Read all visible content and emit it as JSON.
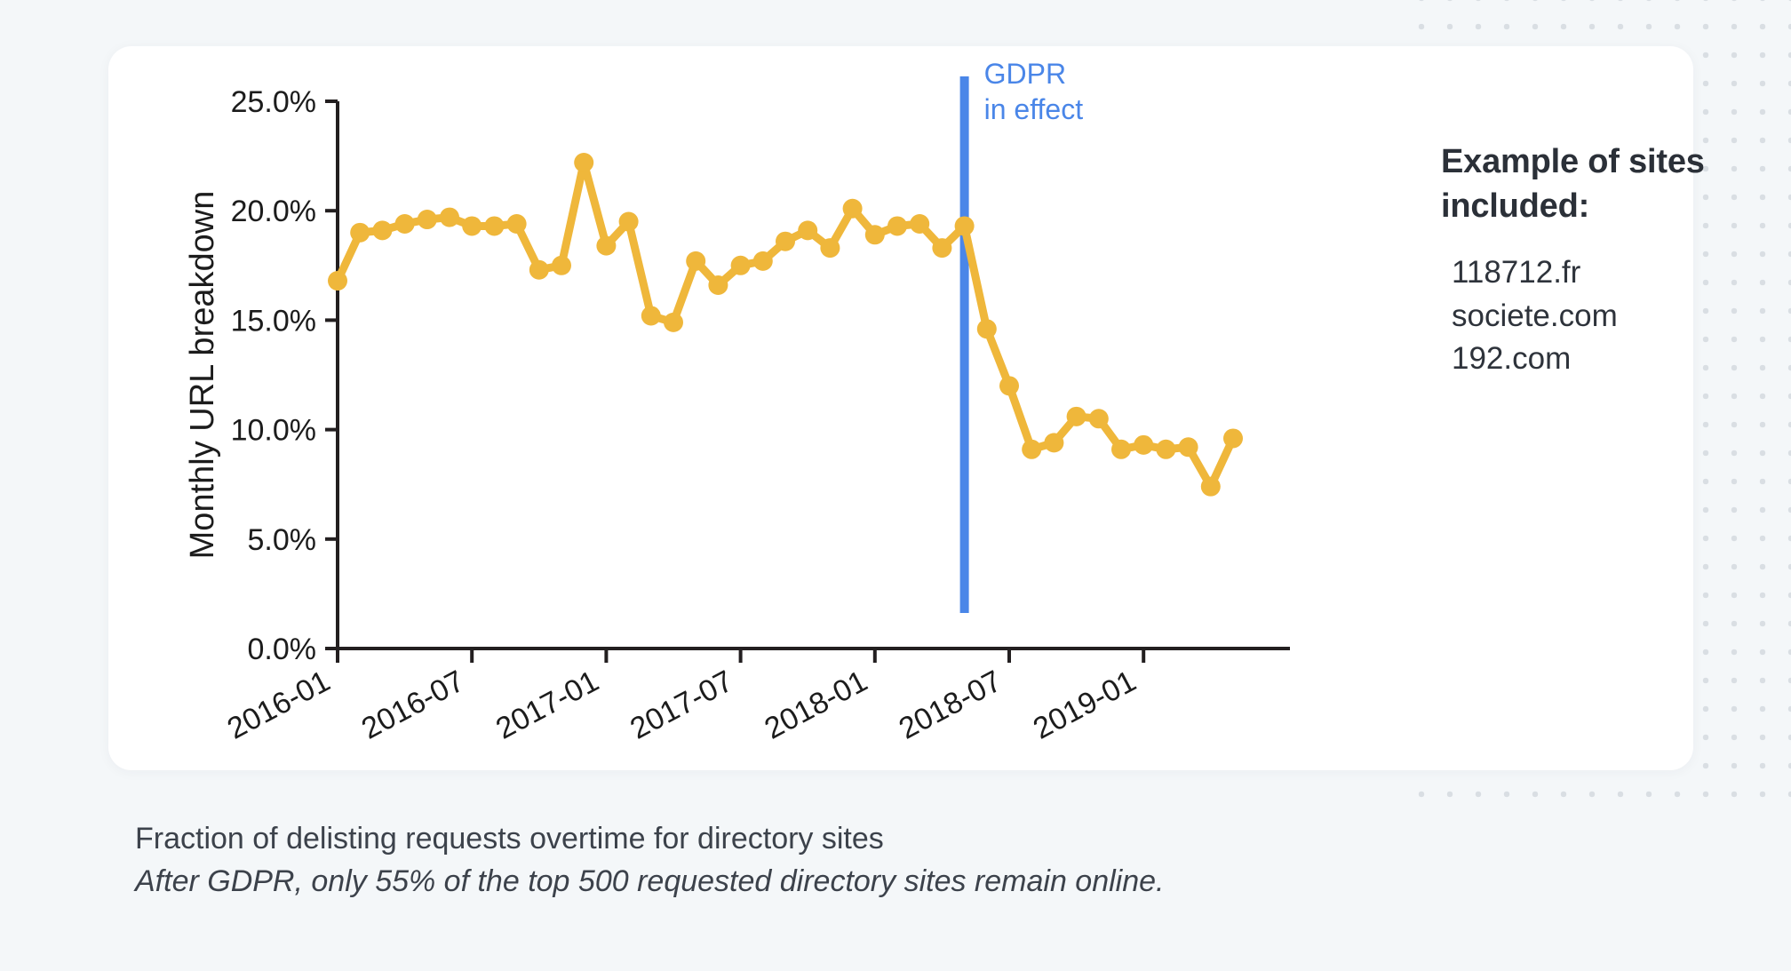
{
  "colors": {
    "page_background": "#f4f7f9",
    "card_background": "#ffffff",
    "series_gold": "#efb73b",
    "gdpr_blue": "#4a86e8",
    "axis_black": "#231f20",
    "text_dark": "#2b3038",
    "dot_grid": "#d9dee3"
  },
  "side_panel": {
    "title": "Example of sites included:",
    "sites": [
      "118712.fr",
      "societe.com",
      "192.com"
    ]
  },
  "caption": {
    "line1": "Fraction of delisting requests overtime for directory sites",
    "line2": "After GDPR, only 55% of the top 500 requested directory sites remain online."
  },
  "chart_data": {
    "type": "line",
    "title": "",
    "xlabel": "",
    "ylabel": "Monthly URL breakdown",
    "ylim": [
      0,
      25
    ],
    "ytick_labels": [
      "0.0%",
      "5.0%",
      "10.0%",
      "15.0%",
      "20.0%",
      "25.0%"
    ],
    "ytick_values": [
      0,
      5,
      10,
      15,
      20,
      25
    ],
    "xtick_labels": [
      "2016-01",
      "2016-07",
      "2017-01",
      "2017-07",
      "2018-01",
      "2018-07",
      "2019-01"
    ],
    "xtick_values": [
      "2016-01",
      "2016-07",
      "2017-01",
      "2017-07",
      "2018-01",
      "2018-07",
      "2019-01"
    ],
    "grid": false,
    "legend": null,
    "marker": "circle",
    "annotations": [
      {
        "name": "gdpr-marker",
        "label_line1": "GDPR",
        "label_line2": "in effect",
        "x": "2018-05",
        "color": "#4a86e8",
        "type": "vline"
      }
    ],
    "x": [
      "2016-01",
      "2016-02",
      "2016-03",
      "2016-04",
      "2016-05",
      "2016-06",
      "2016-07",
      "2016-08",
      "2016-09",
      "2016-10",
      "2016-11",
      "2016-12",
      "2017-01",
      "2017-02",
      "2017-03",
      "2017-04",
      "2017-05",
      "2017-06",
      "2017-07",
      "2017-08",
      "2017-09",
      "2017-10",
      "2017-11",
      "2017-12",
      "2018-01",
      "2018-02",
      "2018-03",
      "2018-04",
      "2018-05",
      "2018-06",
      "2018-07",
      "2018-08",
      "2018-09",
      "2018-10",
      "2018-11",
      "2018-12",
      "2019-01",
      "2019-02",
      "2019-03",
      "2019-04",
      "2019-05"
    ],
    "values": [
      16.8,
      19.0,
      19.1,
      19.4,
      19.6,
      19.7,
      19.3,
      19.3,
      19.4,
      17.3,
      17.5,
      22.2,
      18.4,
      19.5,
      15.2,
      14.9,
      17.7,
      16.6,
      17.5,
      17.7,
      18.6,
      19.1,
      18.3,
      20.1,
      18.9,
      19.3,
      19.4,
      18.3,
      19.3,
      14.6,
      12.0,
      9.1,
      9.4,
      10.6,
      10.5,
      9.1,
      9.3,
      9.1,
      9.2,
      7.4,
      9.6
    ],
    "series": [
      {
        "name": "Monthly URL breakdown",
        "color": "#efb73b",
        "values": [
          16.8,
          19.0,
          19.1,
          19.4,
          19.6,
          19.7,
          19.3,
          19.3,
          19.4,
          17.3,
          17.5,
          22.2,
          18.4,
          19.5,
          15.2,
          14.9,
          17.7,
          16.6,
          17.5,
          17.7,
          18.6,
          19.1,
          18.3,
          20.1,
          18.9,
          19.3,
          19.4,
          18.3,
          19.3,
          14.6,
          12.0,
          9.1,
          9.4,
          10.6,
          10.5,
          9.1,
          9.3,
          9.1,
          9.2,
          7.4,
          9.6
        ]
      }
    ]
  }
}
